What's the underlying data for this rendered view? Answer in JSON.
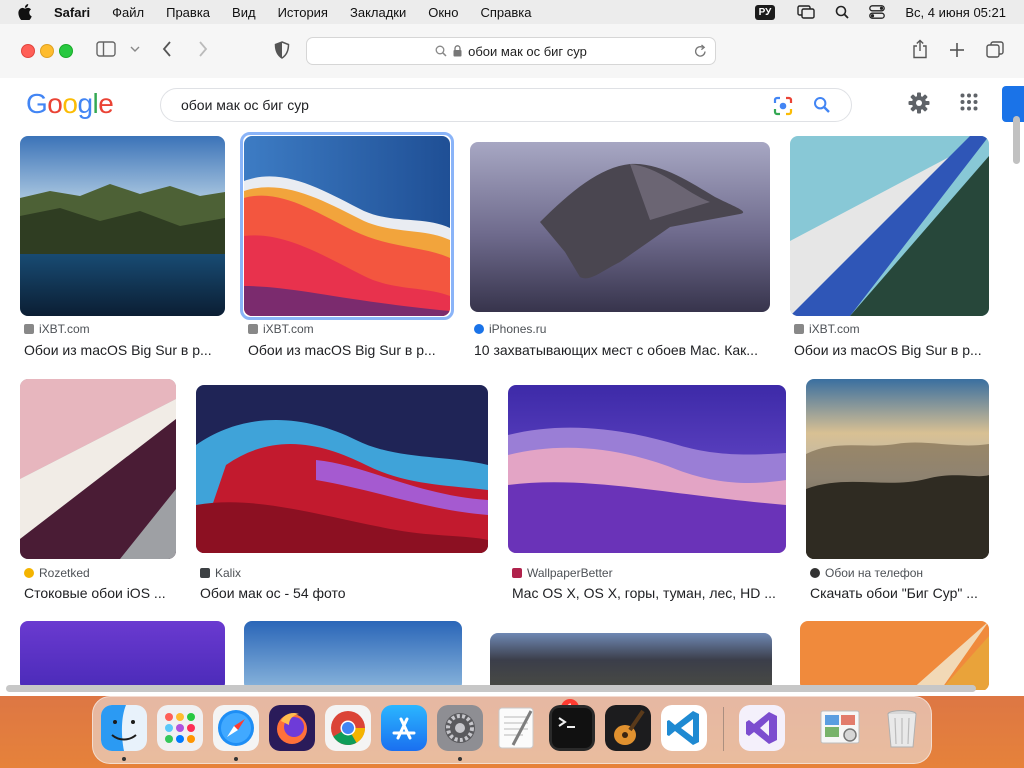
{
  "menubar": {
    "app": "Safari",
    "items": [
      "Файл",
      "Правка",
      "Вид",
      "История",
      "Закладки",
      "Окно",
      "Справка"
    ],
    "lang": "РУ",
    "datetime": "Вс, 4 июня  05:21"
  },
  "browser": {
    "address": "обои мак ос биг сур"
  },
  "google": {
    "logo": [
      "G",
      "o",
      "o",
      "g",
      "l",
      "e"
    ],
    "query": "обои мак ос биг сур"
  },
  "results": [
    {
      "source": "iXBT.com",
      "title": "Обои из macOS Big Sur в р...",
      "fav_color": "#888888"
    },
    {
      "source": "iXBT.com",
      "title": "Обои из macOS Big Sur в р...",
      "fav_color": "#888888"
    },
    {
      "source": "iPhones.ru",
      "title": "10 захватывающих мест с обоев Mac. Как...",
      "fav_color": "#1a73e8"
    },
    {
      "source": "iXBT.com",
      "title": "Обои из macOS Big Sur в р...",
      "fav_color": "#888888"
    },
    {
      "source": "Rozetked",
      "title": "Стоковые обои iOS ...",
      "fav_color": "#f4b400"
    },
    {
      "source": "Kalix",
      "title": "Обои мак ос - 54 фото",
      "fav_color": "#3c4043"
    },
    {
      "source": "WallpaperBetter",
      "title": "Mac OS X, OS X, горы, туман, лес, HD ...",
      "fav_color": "#b0224c"
    },
    {
      "source": "Обои на телефон",
      "title": "Скачать обои \"Биг Сур\" ...",
      "fav_color": "#333333"
    }
  ],
  "dock": {
    "apps": [
      "Finder",
      "Launchpad",
      "Safari",
      "Firefox",
      "Chrome",
      "App Store",
      "System Settings",
      "TextEdit",
      "Terminal",
      "GarageBand",
      "Visual Studio Code",
      "Visual Studio",
      "Preview",
      "Trash"
    ],
    "badge": "1"
  }
}
